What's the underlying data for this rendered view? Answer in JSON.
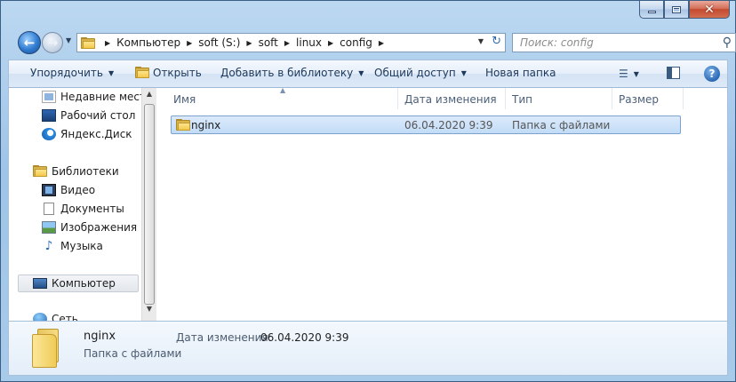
{
  "window": {
    "caption": {
      "minimize": "‒",
      "maximize": "□",
      "close": "✕"
    }
  },
  "nav": {
    "back_icon": "arrow-left-icon",
    "forward_icon": "arrow-right-icon",
    "breadcrumbs": [
      "Компьютер",
      "soft (S:)",
      "soft",
      "linux",
      "config"
    ],
    "search_placeholder": "Поиск: config"
  },
  "toolbar": {
    "organize": "Упорядочить",
    "open": "Открыть",
    "add_to_library": "Добавить в библиотеку",
    "share": "Общий доступ",
    "new_folder": "Новая папка",
    "help": "?"
  },
  "sidebar": {
    "items": [
      {
        "label": "Недавние места",
        "icon": "recent-places-icon"
      },
      {
        "label": "Рабочий стол",
        "icon": "desktop-icon"
      },
      {
        "label": "Яндекс.Диск",
        "icon": "yandex-disk-icon"
      },
      {
        "label": "Библиотеки",
        "icon": "libraries-icon"
      },
      {
        "label": "Видео",
        "icon": "video-icon"
      },
      {
        "label": "Документы",
        "icon": "documents-icon"
      },
      {
        "label": "Изображения",
        "icon": "pictures-icon"
      },
      {
        "label": "Музыка",
        "icon": "music-icon"
      },
      {
        "label": "Компьютер",
        "icon": "computer-icon"
      },
      {
        "label": "Сеть",
        "icon": "network-icon"
      }
    ]
  },
  "columns": [
    "Имя",
    "Дата изменения",
    "Тип",
    "Размер"
  ],
  "files": [
    {
      "name": "nginx",
      "modified": "06.04.2020 9:39",
      "type": "Папка с файлами",
      "size": ""
    }
  ],
  "details": {
    "name": "nginx",
    "modified_label": "Дата изменения:",
    "modified_value": "06.04.2020 9:39",
    "type": "Папка с файлами"
  },
  "colors": {
    "selection": "#c2dcf7",
    "accent": "#2f6ab0",
    "folder": "#f2c94c"
  }
}
